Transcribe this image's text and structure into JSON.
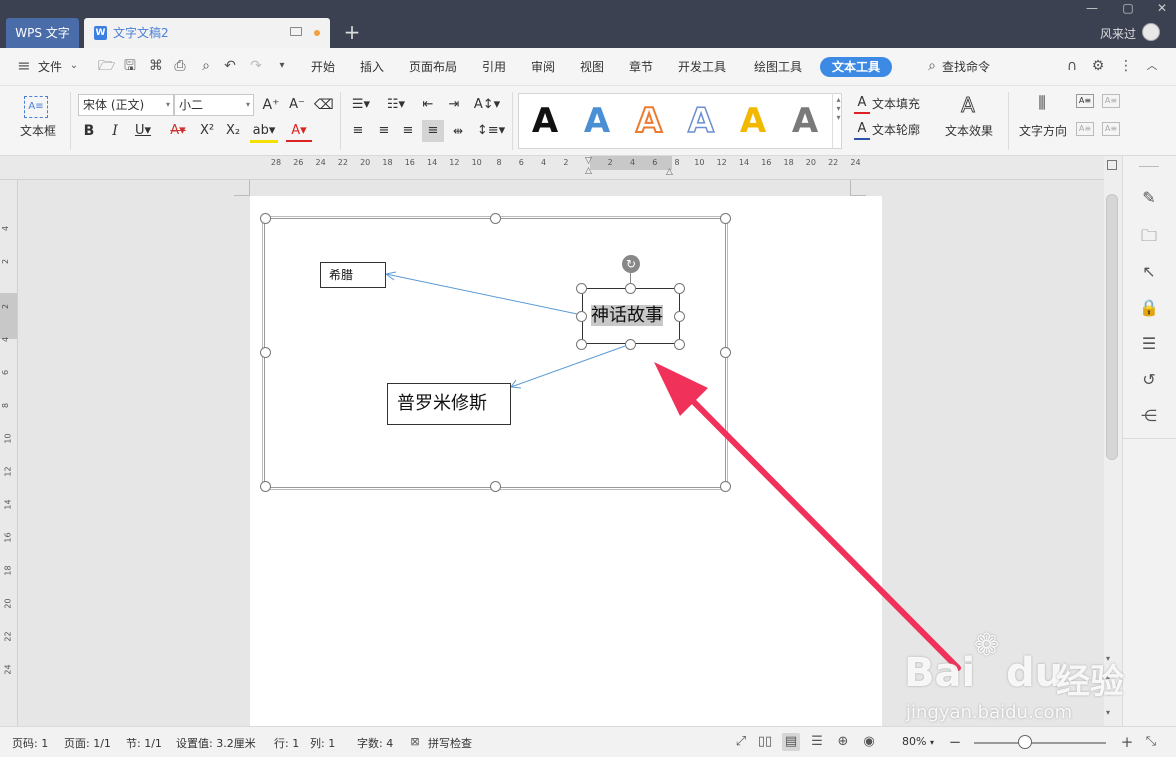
{
  "titlebar": {
    "app_tab": "WPS 文字",
    "doc_tab": "文字文稿2",
    "user": "风来过"
  },
  "menu": {
    "file": "文件",
    "items": [
      "开始",
      "插入",
      "页面布局",
      "引用",
      "审阅",
      "视图",
      "章节",
      "开发工具",
      "绘图工具"
    ],
    "active": "文本工具",
    "search": "查找命令"
  },
  "ribbon": {
    "textbox_label": "文本框",
    "font_name": "宋体 (正文)",
    "font_size": "小二",
    "text_fill": "文本填充",
    "text_outline": "文本轮廓",
    "text_effect": "文本效果",
    "text_direction": "文字方向",
    "gallery_colors": [
      "#111111",
      "#4a8fd4",
      "#ee7a30",
      "#6b8fd0",
      "#f2b800",
      "#7a7a7a"
    ]
  },
  "rulers": {
    "h_marks": [
      "28",
      "26",
      "24",
      "22",
      "20",
      "18",
      "16",
      "14",
      "12",
      "10",
      "8",
      "6",
      "4",
      "2",
      "2",
      "4",
      "6",
      "8",
      "10",
      "12",
      "14",
      "16",
      "18",
      "20",
      "22",
      "24"
    ],
    "v_marks": [
      "4",
      "2",
      "2",
      "4",
      "6",
      "8",
      "10",
      "12",
      "14",
      "16",
      "18",
      "20",
      "22",
      "24"
    ]
  },
  "document": {
    "box_small": "希腊",
    "box_main": "神话故事",
    "box_bottom": "普罗米修斯"
  },
  "status": {
    "page": "页码: 1",
    "pages": "页面: 1/1",
    "section": "节: 1/1",
    "setting": "设置值: 3.2厘米",
    "row": "行: 1",
    "col": "列: 1",
    "words": "字数: 4",
    "spell": "拼写检查",
    "zoom": "80%"
  },
  "watermark": {
    "brand": "Bai",
    "brand_cn": "经验",
    "url": "jingyan.baidu.com"
  },
  "colors": {
    "accent": "#3d8ae5",
    "arrow": "#f0325a",
    "connector": "#5b9bd5"
  }
}
